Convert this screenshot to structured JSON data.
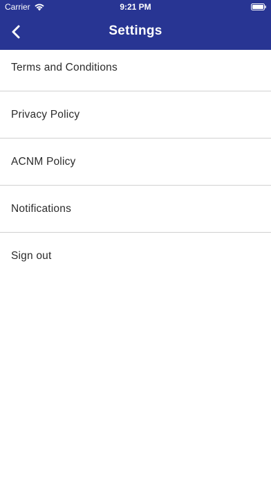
{
  "status_bar": {
    "carrier": "Carrier",
    "time": "9:21 PM"
  },
  "header": {
    "title": "Settings",
    "back_icon": "chevron-left-icon",
    "background_color": "#283593"
  },
  "menu": {
    "items": [
      {
        "label": "Terms and Conditions"
      },
      {
        "label": "Privacy Policy"
      },
      {
        "label": "ACNM Policy"
      },
      {
        "label": "Notifications"
      },
      {
        "label": "Sign out"
      }
    ]
  }
}
